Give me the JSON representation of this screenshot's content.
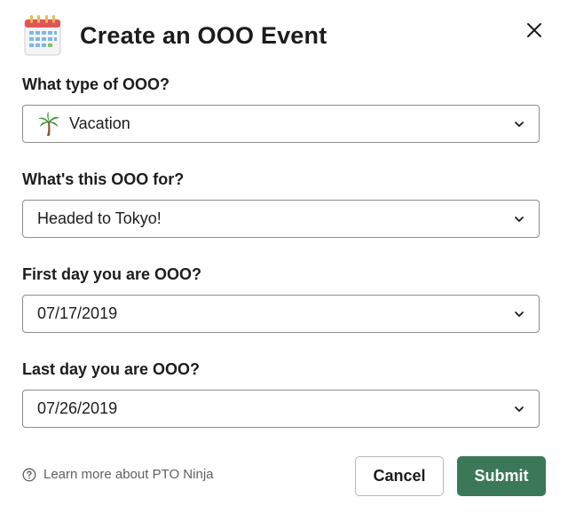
{
  "modal": {
    "title": "Create an OOO Event",
    "icon": "calendar-icon",
    "close_icon": "close-icon"
  },
  "fields": [
    {
      "label": "What type of OOO?",
      "value": "Vacation",
      "icon": "palm-tree-icon"
    },
    {
      "label": "What's this OOO for?",
      "value": "Headed to Tokyo!"
    },
    {
      "label": "First day you are OOO?",
      "value": "07/17/2019"
    },
    {
      "label": "Last day you are OOO?",
      "value": "07/26/2019"
    }
  ],
  "footer": {
    "help_text": "Learn more about PTO Ninja",
    "help_icon": "help-circle-icon",
    "cancel_label": "Cancel",
    "submit_label": "Submit"
  },
  "colors": {
    "submit_bg": "#3b7857",
    "text": "#1d1c1d",
    "muted": "#616061",
    "border": "#8d8d8d"
  }
}
